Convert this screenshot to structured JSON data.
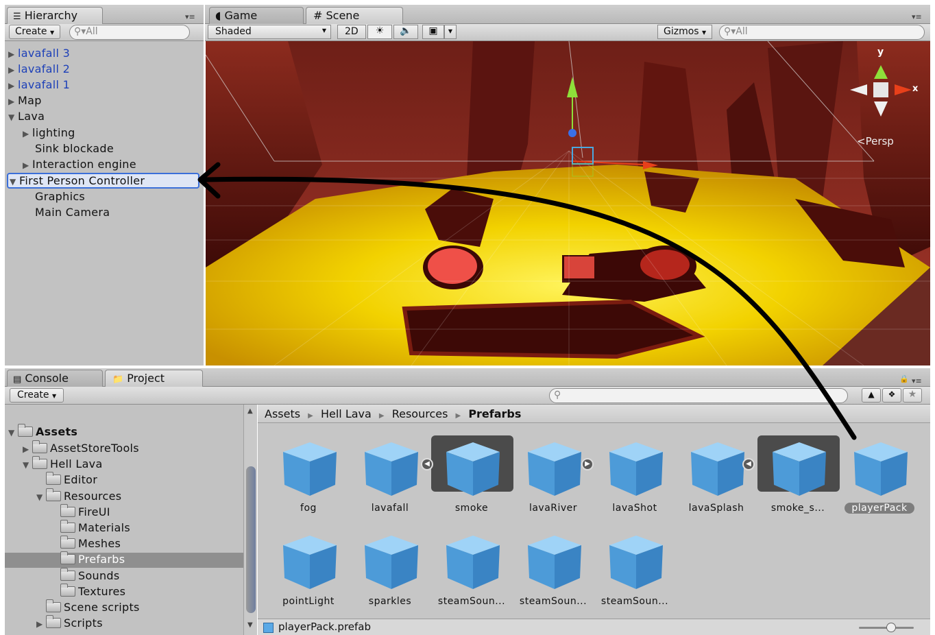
{
  "hierarchy": {
    "tab_label": "Hierarchy",
    "create_label": "Create",
    "search_placeholder": "All",
    "items": [
      {
        "label": "lavafall 3"
      },
      {
        "label": "lavafall 2"
      },
      {
        "label": "lavafall 1"
      },
      {
        "label": "Map"
      },
      {
        "label": "Lava"
      },
      {
        "label": "lighting"
      },
      {
        "label": "Sink blockade"
      },
      {
        "label": "Interaction engine"
      },
      {
        "label": "First Person Controller"
      },
      {
        "label": "Graphics"
      },
      {
        "label": "Main Camera"
      }
    ]
  },
  "scene": {
    "tabs": [
      {
        "label": "Game"
      },
      {
        "label": "Scene"
      }
    ],
    "shading_mode": "Shaded",
    "btn_2d": "2D",
    "gizmos_label": "Gizmos",
    "search_placeholder": "All",
    "gizmo_y": "y",
    "gizmo_x": "x",
    "persp_label": "Persp"
  },
  "bottom": {
    "tabs": [
      {
        "label": "Console"
      },
      {
        "label": "Project"
      }
    ],
    "create_label": "Create"
  },
  "project_tree": {
    "items": [
      {
        "label": "Assets"
      },
      {
        "label": "AssetStoreTools"
      },
      {
        "label": "Hell Lava"
      },
      {
        "label": "Editor"
      },
      {
        "label": "Resources"
      },
      {
        "label": "FireUI"
      },
      {
        "label": "Materials"
      },
      {
        "label": "Meshes"
      },
      {
        "label": "Prefarbs"
      },
      {
        "label": "Sounds"
      },
      {
        "label": "Textures"
      },
      {
        "label": "Scene scripts"
      },
      {
        "label": "Scripts"
      }
    ]
  },
  "breadcrumb": {
    "items": [
      {
        "label": "Assets"
      },
      {
        "label": "Hell Lava"
      },
      {
        "label": "Resources"
      },
      {
        "label": "Prefarbs"
      }
    ]
  },
  "assets": {
    "items": [
      {
        "label": "fog"
      },
      {
        "label": "lavafall"
      },
      {
        "label": "smoke"
      },
      {
        "label": "lavaRiver"
      },
      {
        "label": "lavaShot"
      },
      {
        "label": "lavaSplash"
      },
      {
        "label": "smoke_s..."
      },
      {
        "label": "playerPack"
      },
      {
        "label": "pointLight"
      },
      {
        "label": "sparkles"
      },
      {
        "label": "steamSoun..."
      },
      {
        "label": "steamSoun..."
      },
      {
        "label": "steamSoun..."
      }
    ]
  },
  "status": {
    "selected_file": "playerPack.prefab"
  },
  "colors": {
    "accent_selection": "#3b6fd9",
    "lava_yellow": "#f2d200",
    "lava_red": "#d8241a",
    "cube_blue": "#5aa9e6"
  }
}
